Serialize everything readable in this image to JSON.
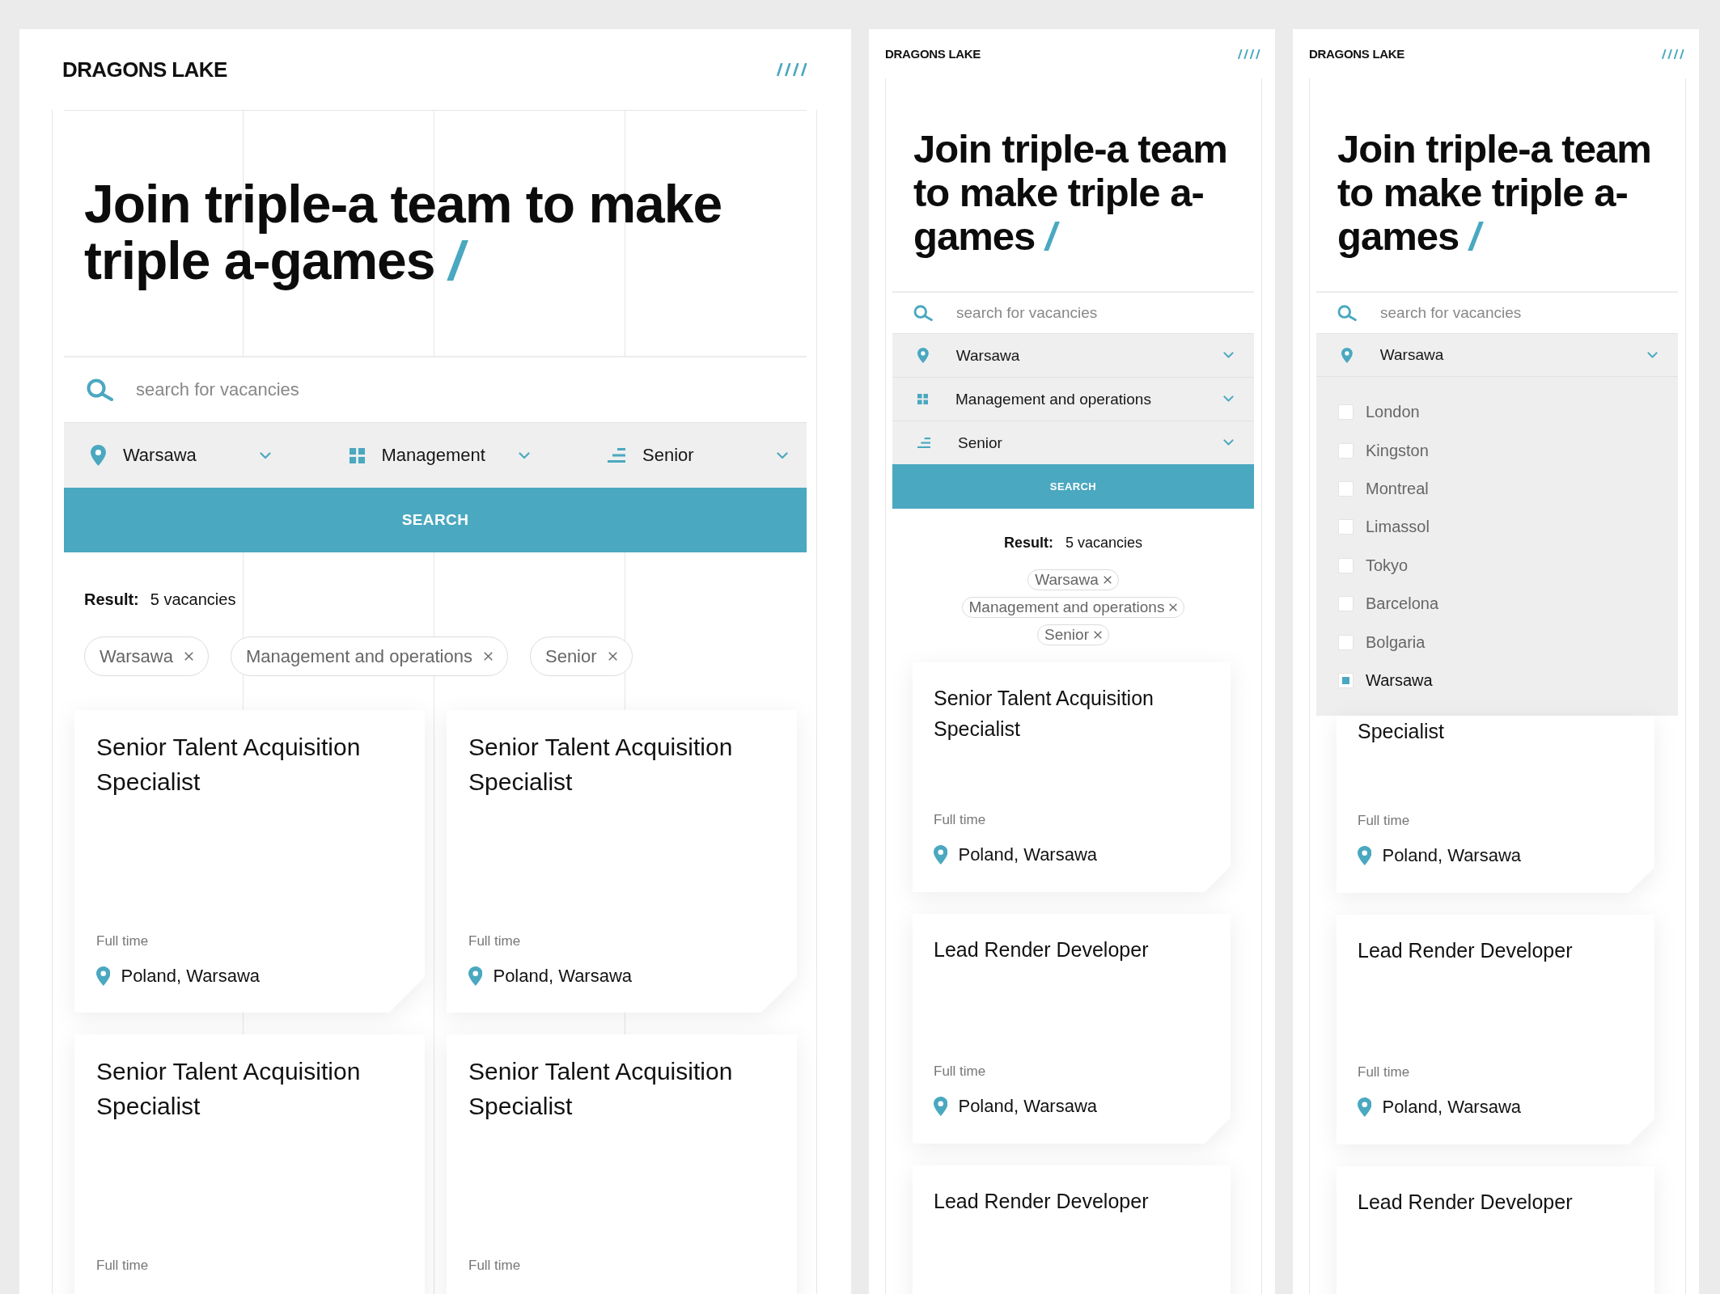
{
  "screens": [
    {
      "kind": "desktop",
      "logo": "DRAGONS LAKE",
      "title": "Join triple-a team to make triple a-games",
      "title_mark": "/",
      "search": {
        "placeholder": "search for vacancies"
      },
      "filters": [
        {
          "kind": "location",
          "value": "Warsawa",
          "expanded": false
        },
        {
          "kind": "category",
          "value": "Management",
          "expanded": false
        },
        {
          "kind": "level",
          "value": "Senior",
          "expanded": false
        }
      ],
      "search_button": "SEARCH",
      "result": {
        "label": "Result:",
        "count": "5 vacancies"
      },
      "chips": [
        "Warsawa",
        "Management and operations",
        "Senior"
      ],
      "cards": [
        {
          "title": "Senior Talent Acquisition Specialist",
          "employment": "Full time",
          "location": "Poland, Warsawa"
        },
        {
          "title": "Senior Talent Acquisition Specialist",
          "employment": "Full time",
          "location": "Poland, Warsawa"
        },
        {
          "title": "Senior Talent Acquisition Specialist",
          "employment": "Full time"
        },
        {
          "title": "Senior Talent Acquisition Specialist",
          "employment": "Full time"
        }
      ]
    },
    {
      "kind": "mobile",
      "logo": "DRAGONS LAKE",
      "title": "Join triple-a team to make triple a-games",
      "title_mark": "/",
      "search": {
        "placeholder": "search for vacancies"
      },
      "filters": [
        {
          "kind": "location",
          "value": "Warsawa",
          "expanded": false
        },
        {
          "kind": "category",
          "value": "Management and operations",
          "expanded": false
        },
        {
          "kind": "level",
          "value": "Senior",
          "expanded": false
        }
      ],
      "search_button": "SEARCH",
      "result": {
        "label": "Result:",
        "count": "5 vacancies"
      },
      "chips": [
        "Warsawa",
        "Management and operations",
        "Senior"
      ],
      "cards": [
        {
          "title": "Senior Talent Acquisition Specialist",
          "employment": "Full time",
          "location": "Poland, Warsawa"
        },
        {
          "title": "Lead Render Developer",
          "employment": "Full time",
          "location": "Poland, Warsawa"
        },
        {
          "title": "Lead Render Developer"
        }
      ]
    },
    {
      "kind": "mobile",
      "logo": "DRAGONS LAKE",
      "title": "Join triple-a team to make triple a-games",
      "title_mark": "/",
      "search": {
        "placeholder": "search for vacancies"
      },
      "filters": [
        {
          "kind": "location",
          "value": "Warsawa",
          "expanded": true,
          "options": [
            {
              "label": "London",
              "checked": false
            },
            {
              "label": "Kingston",
              "checked": false
            },
            {
              "label": "Montreal",
              "checked": false
            },
            {
              "label": "Limassol",
              "checked": false
            },
            {
              "label": "Tokyo",
              "checked": false
            },
            {
              "label": "Barcelona",
              "checked": false
            },
            {
              "label": "Bolgaria",
              "checked": false
            },
            {
              "label": "Warsawa",
              "checked": true
            }
          ]
        }
      ],
      "cards": [
        {
          "title": "Specialist",
          "employment": "Full time",
          "location": "Poland, Warsawa"
        },
        {
          "title": "Lead Render Developer",
          "employment": "Full time",
          "location": "Poland, Warsawa"
        },
        {
          "title": "Lead Render Developer"
        }
      ]
    }
  ]
}
